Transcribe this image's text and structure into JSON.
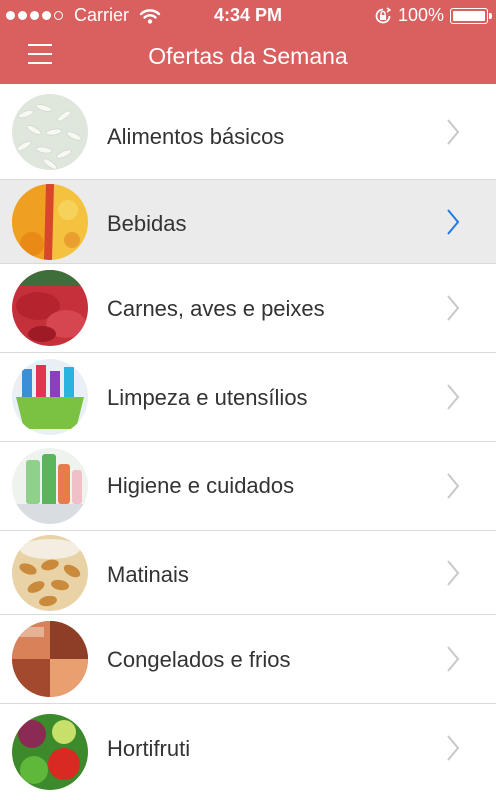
{
  "status_bar": {
    "carrier": "Carrier",
    "time": "4:34 PM",
    "battery": "100%"
  },
  "header": {
    "title": "Ofertas da Semana",
    "menu_icon": "hamburger-menu-icon"
  },
  "categories": [
    {
      "label": "Alimentos básicos",
      "selected": false,
      "image": "rice-photo"
    },
    {
      "label": "Bebidas",
      "selected": true,
      "image": "drinks-photo"
    },
    {
      "label": "Carnes, aves e peixes",
      "selected": false,
      "image": "meat-photo"
    },
    {
      "label": "Limpeza e utensílios",
      "selected": false,
      "image": "cleaning-products-photo"
    },
    {
      "label": "Higiene e cuidados",
      "selected": false,
      "image": "hygiene-products-photo"
    },
    {
      "label": "Matinais",
      "selected": false,
      "image": "breakfast-cereal-photo"
    },
    {
      "label": "Congelados e frios",
      "selected": false,
      "image": "frozen-food-photo"
    },
    {
      "label": "Hortifruti",
      "selected": false,
      "image": "vegetables-photo"
    }
  ],
  "colors": {
    "header": "#d9605f",
    "chevron": "#c8c8c8",
    "chevron_selected": "#1f7ae6",
    "selected_row": "#ebebeb"
  }
}
